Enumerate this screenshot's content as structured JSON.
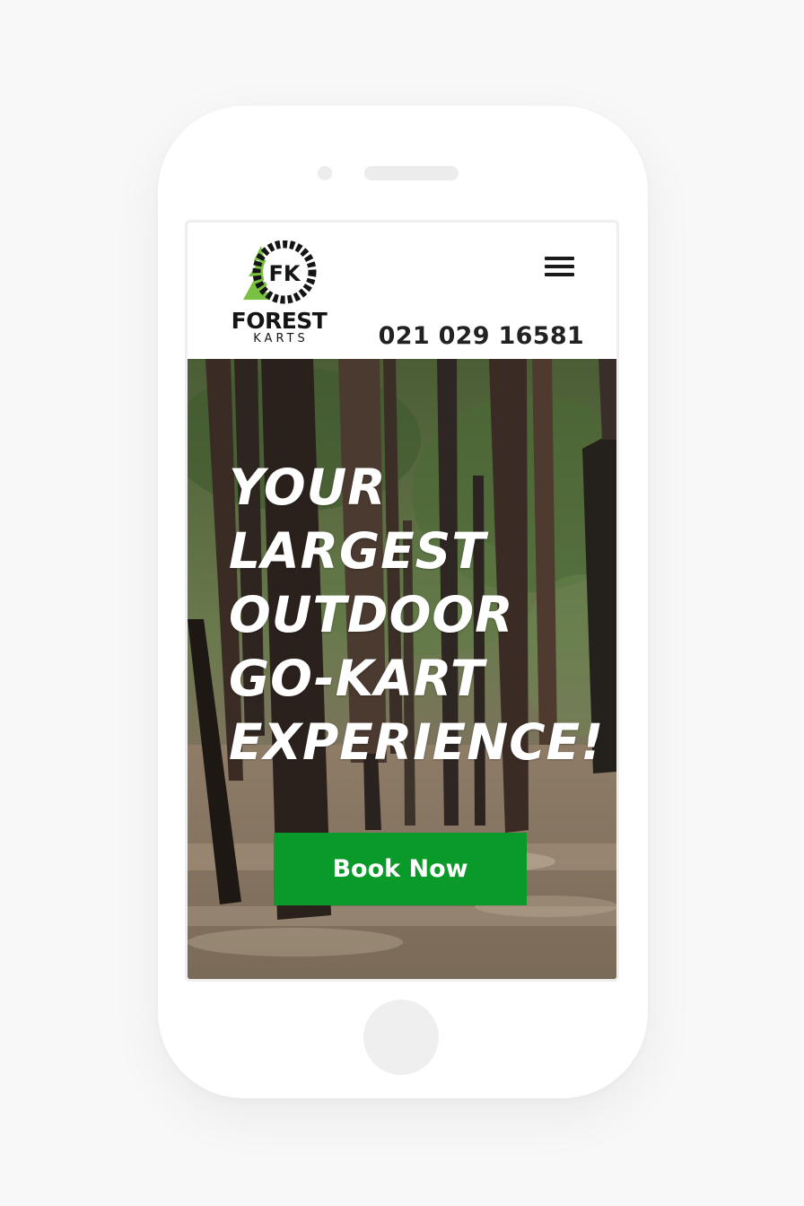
{
  "brand": {
    "logo_initials": "FK",
    "name": "FOREST",
    "sub": "KARTS",
    "tree_color": "#7ac142",
    "wheel_color": "#151515"
  },
  "header": {
    "phone": "021 029 16581",
    "menu_icon": "hamburger-menu-icon"
  },
  "hero": {
    "title_lines": [
      "YOUR",
      "LARGEST",
      "OUTDOOR",
      "GO-KART",
      "EXPERIENCE!"
    ],
    "cta_label": "Book Now",
    "cta_color": "#0a9a29",
    "background": "forest-photo"
  }
}
